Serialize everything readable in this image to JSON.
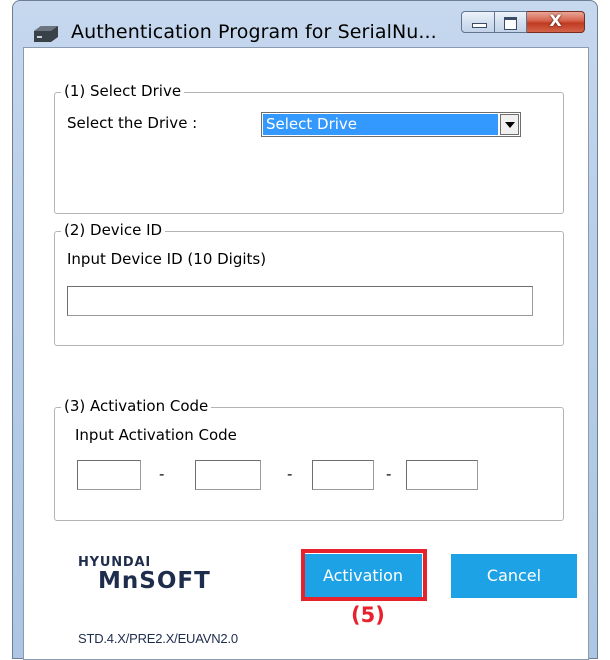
{
  "window": {
    "title": "Authentication Program for SerialNu...",
    "close_glyph": "X"
  },
  "drive_group": {
    "legend": "(1) Select Drive",
    "label": "Select the Drive :",
    "selected": "Select Drive"
  },
  "device_group": {
    "legend": "(2) Device ID",
    "label": "Input Device ID (10 Digits)",
    "value": ""
  },
  "activation_group": {
    "legend": "(3) Activation Code",
    "label": "Input Activation Code",
    "separator": "-",
    "fields": [
      "",
      "",
      "",
      ""
    ]
  },
  "logo": {
    "line1": "HYUNDAI",
    "line2": "MnSOFT"
  },
  "buttons": {
    "activation": "Activation",
    "cancel": "Cancel"
  },
  "annotation": {
    "step": "(5)",
    "color": "#e8222c"
  },
  "version": "STD.4.X/PRE2.X/EUAVN2.0",
  "colors": {
    "button": "#1ea2e6",
    "selection": "#3399ff",
    "logo": "#1f2d4d"
  },
  "icons": {
    "app": "drive-icon",
    "minimize": "minimize-icon",
    "maximize": "maximize-icon",
    "close": "close-icon",
    "dropdown": "chevron-down-icon"
  }
}
